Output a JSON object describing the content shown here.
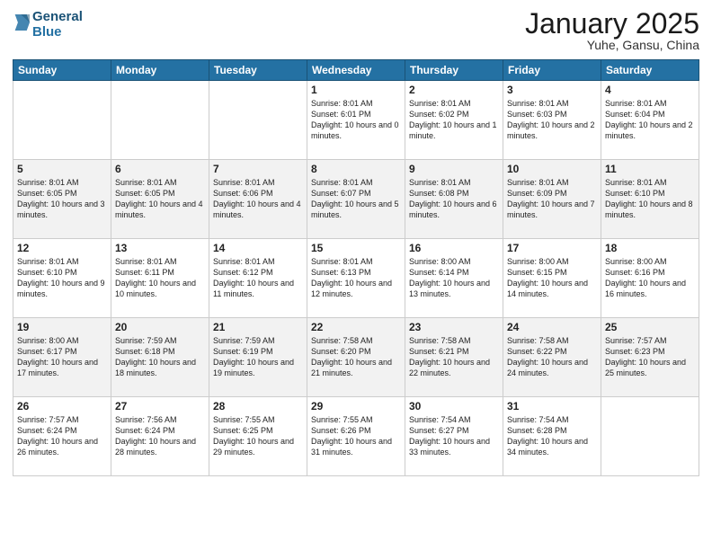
{
  "logo": {
    "line1": "General",
    "line2": "Blue"
  },
  "title": "January 2025",
  "subtitle": "Yuhe, Gansu, China",
  "weekdays": [
    "Sunday",
    "Monday",
    "Tuesday",
    "Wednesday",
    "Thursday",
    "Friday",
    "Saturday"
  ],
  "weeks": [
    [
      {
        "day": "",
        "sunrise": "",
        "sunset": "",
        "daylight": ""
      },
      {
        "day": "",
        "sunrise": "",
        "sunset": "",
        "daylight": ""
      },
      {
        "day": "",
        "sunrise": "",
        "sunset": "",
        "daylight": ""
      },
      {
        "day": "1",
        "sunrise": "Sunrise: 8:01 AM",
        "sunset": "Sunset: 6:01 PM",
        "daylight": "Daylight: 10 hours and 0 minutes."
      },
      {
        "day": "2",
        "sunrise": "Sunrise: 8:01 AM",
        "sunset": "Sunset: 6:02 PM",
        "daylight": "Daylight: 10 hours and 1 minute."
      },
      {
        "day": "3",
        "sunrise": "Sunrise: 8:01 AM",
        "sunset": "Sunset: 6:03 PM",
        "daylight": "Daylight: 10 hours and 2 minutes."
      },
      {
        "day": "4",
        "sunrise": "Sunrise: 8:01 AM",
        "sunset": "Sunset: 6:04 PM",
        "daylight": "Daylight: 10 hours and 2 minutes."
      }
    ],
    [
      {
        "day": "5",
        "sunrise": "Sunrise: 8:01 AM",
        "sunset": "Sunset: 6:05 PM",
        "daylight": "Daylight: 10 hours and 3 minutes."
      },
      {
        "day": "6",
        "sunrise": "Sunrise: 8:01 AM",
        "sunset": "Sunset: 6:05 PM",
        "daylight": "Daylight: 10 hours and 4 minutes."
      },
      {
        "day": "7",
        "sunrise": "Sunrise: 8:01 AM",
        "sunset": "Sunset: 6:06 PM",
        "daylight": "Daylight: 10 hours and 4 minutes."
      },
      {
        "day": "8",
        "sunrise": "Sunrise: 8:01 AM",
        "sunset": "Sunset: 6:07 PM",
        "daylight": "Daylight: 10 hours and 5 minutes."
      },
      {
        "day": "9",
        "sunrise": "Sunrise: 8:01 AM",
        "sunset": "Sunset: 6:08 PM",
        "daylight": "Daylight: 10 hours and 6 minutes."
      },
      {
        "day": "10",
        "sunrise": "Sunrise: 8:01 AM",
        "sunset": "Sunset: 6:09 PM",
        "daylight": "Daylight: 10 hours and 7 minutes."
      },
      {
        "day": "11",
        "sunrise": "Sunrise: 8:01 AM",
        "sunset": "Sunset: 6:10 PM",
        "daylight": "Daylight: 10 hours and 8 minutes."
      }
    ],
    [
      {
        "day": "12",
        "sunrise": "Sunrise: 8:01 AM",
        "sunset": "Sunset: 6:10 PM",
        "daylight": "Daylight: 10 hours and 9 minutes."
      },
      {
        "day": "13",
        "sunrise": "Sunrise: 8:01 AM",
        "sunset": "Sunset: 6:11 PM",
        "daylight": "Daylight: 10 hours and 10 minutes."
      },
      {
        "day": "14",
        "sunrise": "Sunrise: 8:01 AM",
        "sunset": "Sunset: 6:12 PM",
        "daylight": "Daylight: 10 hours and 11 minutes."
      },
      {
        "day": "15",
        "sunrise": "Sunrise: 8:01 AM",
        "sunset": "Sunset: 6:13 PM",
        "daylight": "Daylight: 10 hours and 12 minutes."
      },
      {
        "day": "16",
        "sunrise": "Sunrise: 8:00 AM",
        "sunset": "Sunset: 6:14 PM",
        "daylight": "Daylight: 10 hours and 13 minutes."
      },
      {
        "day": "17",
        "sunrise": "Sunrise: 8:00 AM",
        "sunset": "Sunset: 6:15 PM",
        "daylight": "Daylight: 10 hours and 14 minutes."
      },
      {
        "day": "18",
        "sunrise": "Sunrise: 8:00 AM",
        "sunset": "Sunset: 6:16 PM",
        "daylight": "Daylight: 10 hours and 16 minutes."
      }
    ],
    [
      {
        "day": "19",
        "sunrise": "Sunrise: 8:00 AM",
        "sunset": "Sunset: 6:17 PM",
        "daylight": "Daylight: 10 hours and 17 minutes."
      },
      {
        "day": "20",
        "sunrise": "Sunrise: 7:59 AM",
        "sunset": "Sunset: 6:18 PM",
        "daylight": "Daylight: 10 hours and 18 minutes."
      },
      {
        "day": "21",
        "sunrise": "Sunrise: 7:59 AM",
        "sunset": "Sunset: 6:19 PM",
        "daylight": "Daylight: 10 hours and 19 minutes."
      },
      {
        "day": "22",
        "sunrise": "Sunrise: 7:58 AM",
        "sunset": "Sunset: 6:20 PM",
        "daylight": "Daylight: 10 hours and 21 minutes."
      },
      {
        "day": "23",
        "sunrise": "Sunrise: 7:58 AM",
        "sunset": "Sunset: 6:21 PM",
        "daylight": "Daylight: 10 hours and 22 minutes."
      },
      {
        "day": "24",
        "sunrise": "Sunrise: 7:58 AM",
        "sunset": "Sunset: 6:22 PM",
        "daylight": "Daylight: 10 hours and 24 minutes."
      },
      {
        "day": "25",
        "sunrise": "Sunrise: 7:57 AM",
        "sunset": "Sunset: 6:23 PM",
        "daylight": "Daylight: 10 hours and 25 minutes."
      }
    ],
    [
      {
        "day": "26",
        "sunrise": "Sunrise: 7:57 AM",
        "sunset": "Sunset: 6:24 PM",
        "daylight": "Daylight: 10 hours and 26 minutes."
      },
      {
        "day": "27",
        "sunrise": "Sunrise: 7:56 AM",
        "sunset": "Sunset: 6:24 PM",
        "daylight": "Daylight: 10 hours and 28 minutes."
      },
      {
        "day": "28",
        "sunrise": "Sunrise: 7:55 AM",
        "sunset": "Sunset: 6:25 PM",
        "daylight": "Daylight: 10 hours and 29 minutes."
      },
      {
        "day": "29",
        "sunrise": "Sunrise: 7:55 AM",
        "sunset": "Sunset: 6:26 PM",
        "daylight": "Daylight: 10 hours and 31 minutes."
      },
      {
        "day": "30",
        "sunrise": "Sunrise: 7:54 AM",
        "sunset": "Sunset: 6:27 PM",
        "daylight": "Daylight: 10 hours and 33 minutes."
      },
      {
        "day": "31",
        "sunrise": "Sunrise: 7:54 AM",
        "sunset": "Sunset: 6:28 PM",
        "daylight": "Daylight: 10 hours and 34 minutes."
      },
      {
        "day": "",
        "sunrise": "",
        "sunset": "",
        "daylight": ""
      }
    ]
  ]
}
